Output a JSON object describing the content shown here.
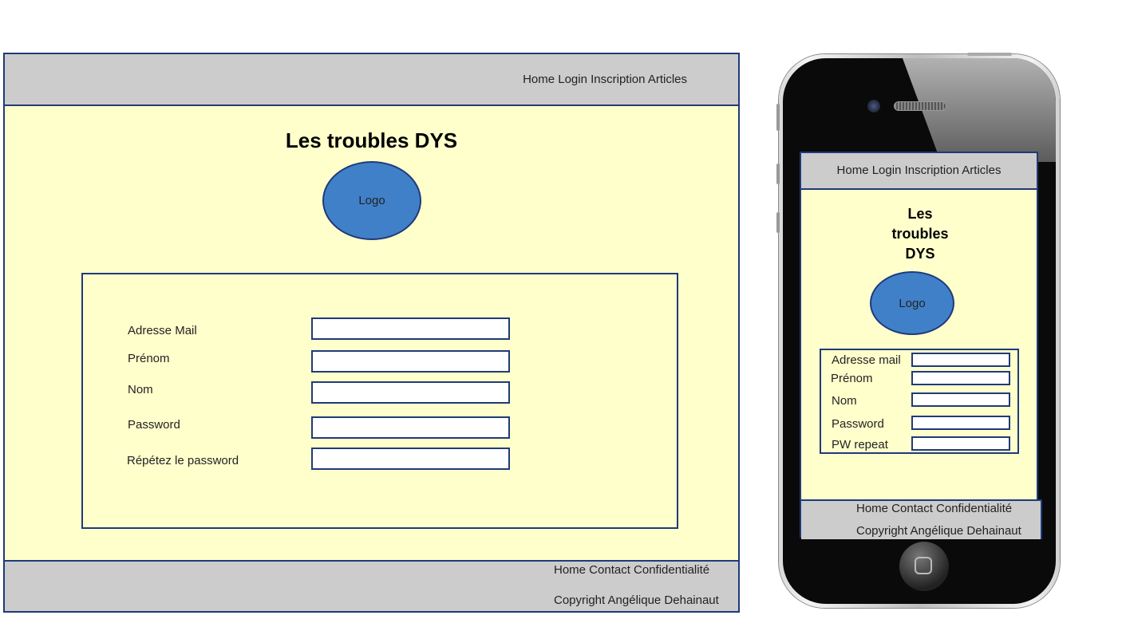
{
  "desktop": {
    "nav": "Home Login Inscription Articles",
    "title": "Les troubles DYS",
    "logo_label": "Logo",
    "form": {
      "fields": [
        {
          "label": "Adresse Mail",
          "value": ""
        },
        {
          "label": "Prénom",
          "value": ""
        },
        {
          "label": "Nom",
          "value": ""
        },
        {
          "label": "Password",
          "value": ""
        },
        {
          "label": "Répétez le password",
          "value": ""
        }
      ]
    },
    "footer": {
      "links": "Home Contact Confidentialité",
      "copyright": "Copyright Angélique Dehainaut"
    }
  },
  "mobile": {
    "nav": "Home Login Inscription Articles",
    "title_lines": [
      "Les",
      "troubles",
      "DYS"
    ],
    "logo_label": "Logo",
    "form": {
      "fields": [
        {
          "label": "Adresse mail",
          "value": ""
        },
        {
          "label": "Prénom",
          "value": ""
        },
        {
          "label": "Nom",
          "value": ""
        },
        {
          "label": "Password",
          "value": ""
        },
        {
          "label": "PW repeat",
          "value": ""
        }
      ]
    },
    "footer": {
      "links": "Home Contact Confidentialité",
      "copyright": "Copyright Angélique Dehainaut"
    }
  },
  "colors": {
    "page_background": "#ffffcc",
    "bar_background": "#cccccc",
    "border": "#1f3a7a",
    "logo_fill": "#4080c8"
  }
}
